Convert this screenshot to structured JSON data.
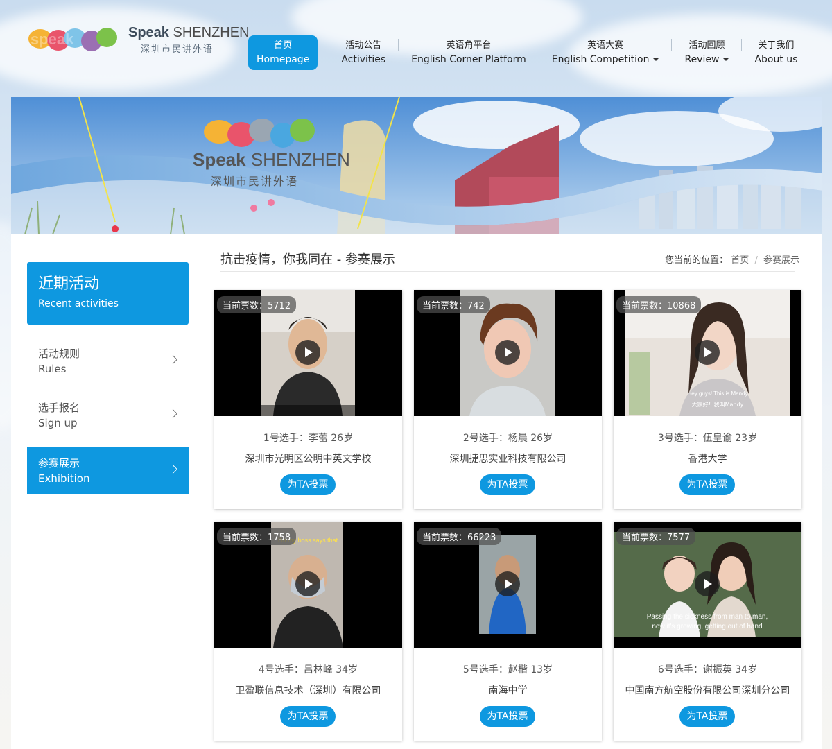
{
  "header": {
    "logo_en_bold": "Speak",
    "logo_en": "SHENZHEN",
    "logo_cn": "深圳市民讲外语",
    "nav": [
      {
        "cn": "首页",
        "en": "Homepage",
        "active": true
      },
      {
        "cn": "活动公告",
        "en": "Activities"
      },
      {
        "cn": "英语角平台",
        "en": "English Corner Platform"
      },
      {
        "cn": "英语大赛",
        "en": "English Competition",
        "dropdown": true
      },
      {
        "cn": "活动回顾",
        "en": "Review",
        "dropdown": true
      },
      {
        "cn": "关于我们",
        "en": "About us"
      }
    ]
  },
  "banner": {
    "logo_en_bold": "Speak",
    "logo_en": "SHENZHEN",
    "logo_cn": "深圳市民讲外语"
  },
  "sidebar": {
    "head_cn": "近期活动",
    "head_en": "Recent activities",
    "items": [
      {
        "cn": "活动规则",
        "en": "Rules"
      },
      {
        "cn": "选手报名",
        "en": "Sign up"
      },
      {
        "cn": "参赛展示",
        "en": "Exhibition",
        "active": true
      }
    ]
  },
  "main": {
    "title": "抗击疫情，你我同在 - 参赛展示",
    "breadcrumb": {
      "label": "您当前的位置：",
      "home": "首页",
      "sep": "/",
      "current": "参赛展示"
    },
    "vote_button": "为TA投票",
    "cards": [
      {
        "votes": "当前票数：5712",
        "name": "1号选手：李蕾 26岁",
        "org": "深圳市光明区公明中英文学校"
      },
      {
        "votes": "当前票数：742",
        "name": "2号选手：杨晨 26岁",
        "org": "深圳捷思实业科技有限公司"
      },
      {
        "votes": "当前票数：10868",
        "name": "3号选手：伍皇谕 23岁",
        "org": "香港大学",
        "caption1": "Hey guys! This is Mandy",
        "caption2": "大家好！我叫Mandy"
      },
      {
        "votes": "当前票数：1758",
        "name": "4号选手：吕林峰 34岁",
        "org": "卫盈联信息技术（深圳）有限公司",
        "caption1": "I'm my boss says that"
      },
      {
        "votes": "当前票数：66223",
        "name": "5号选手：赵楷 13岁",
        "org": "南海中学"
      },
      {
        "votes": "当前票数：7577",
        "name": "6号选手：谢振英 34岁",
        "org": "中国南方航空股份有限公司深圳分公司",
        "caption1": "Passing the sickness from man to man,",
        "caption2": "now it's growing, getting out of hand"
      }
    ]
  },
  "colors": {
    "accent": "#0e98e0",
    "text": "#333333"
  }
}
